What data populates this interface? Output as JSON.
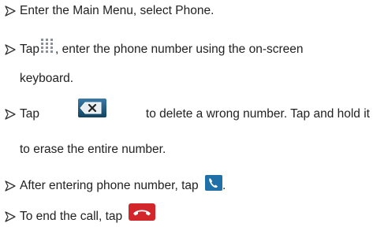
{
  "items": [
    {
      "text": "Enter the Main Menu, select Phone."
    },
    {
      "before": "Tap",
      "after": ", enter the phone number using the on-screen",
      "cont": "keyboard.",
      "icon": "dialpad-icon"
    },
    {
      "before": "Tap",
      "after": "to delete a wrong number. Tap and hold it",
      "cont": "to erase the entire number.",
      "icon": "backspace-delete-icon"
    },
    {
      "before": "After entering phone number, tap",
      "after": ".",
      "icon": "call-handset-icon"
    },
    {
      "before": "To end the call, tap",
      "icon": "end-call-icon"
    }
  ],
  "colors": {
    "text": "#222222",
    "bullet": "#333333",
    "call_icon": "#1f6fa8",
    "end_call": "#d2262b"
  }
}
